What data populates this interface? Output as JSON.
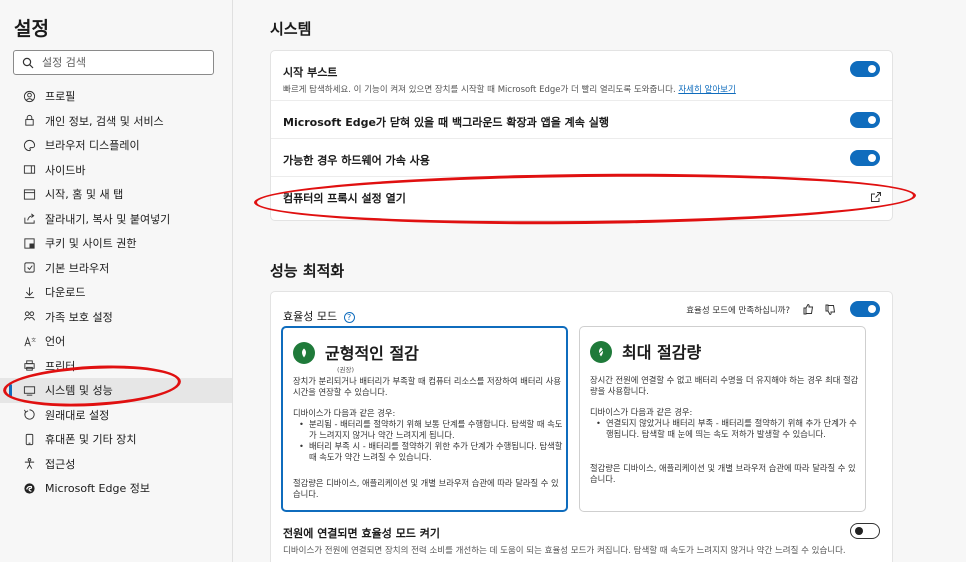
{
  "sidebar": {
    "title": "설정",
    "search_placeholder": "설정 검색",
    "items": [
      {
        "label": "프로필",
        "icon": "profile-icon"
      },
      {
        "label": "개인 정보, 검색 및 서비스",
        "icon": "lock-icon"
      },
      {
        "label": "브라우저 디스플레이",
        "icon": "palette-icon"
      },
      {
        "label": "사이드바",
        "icon": "sidebar-icon"
      },
      {
        "label": "시작, 홈 및 새 탭",
        "icon": "home-tab-icon"
      },
      {
        "label": "잘라내기, 복사 및 붙여넣기",
        "icon": "share-icon"
      },
      {
        "label": "쿠키 및 사이트 권한",
        "icon": "cookie-permissions-icon"
      },
      {
        "label": "기본 브라우저",
        "icon": "default-browser-icon"
      },
      {
        "label": "다운로드",
        "icon": "download-icon"
      },
      {
        "label": "가족 보호 설정",
        "icon": "family-icon"
      },
      {
        "label": "언어",
        "icon": "language-icon"
      },
      {
        "label": "프린터",
        "icon": "printer-icon"
      },
      {
        "label": "시스템 및 성능",
        "icon": "system-icon",
        "active": true
      },
      {
        "label": "원래대로 설정",
        "icon": "reset-icon"
      },
      {
        "label": "휴대폰 및 기타 장치",
        "icon": "phone-icon"
      },
      {
        "label": "접근성",
        "icon": "accessibility-icon"
      },
      {
        "label": "Microsoft Edge 정보",
        "icon": "edge-icon"
      }
    ]
  },
  "system": {
    "title": "시스템",
    "startup_boost": {
      "title": "시작 부스트",
      "desc": "빠르게 탐색하세요. 이 기능이 켜져 있으면 장치를 시작할 때 Microsoft Edge가 더 빨리 열리도록 도와줍니다.",
      "link": "자세히 알아보기",
      "enabled": true
    },
    "background": {
      "title": "Microsoft Edge가 닫혀 있을 때 백그라운드 확장과 앱을 계속 실행",
      "enabled": true
    },
    "hardware_accel": {
      "title": "가능한 경우 하드웨어 가속 사용",
      "enabled": true
    },
    "proxy": {
      "title": "컴퓨터의 프록시 설정 열기",
      "icon": "external-link-icon"
    }
  },
  "performance": {
    "title": "성능 최적화",
    "efficiency_mode": {
      "label": "효율성 모드",
      "feedback_prompt": "효율성 모드에 만족하십니까?",
      "enabled": true
    },
    "balanced": {
      "title": "균형적인 절감",
      "sub": "(권장)",
      "desc": "장치가 분리되거나 배터리가 부족할 때 컴퓨터 리소스를 저장하여 배터리 사용 시간을 연장할 수 있습니다.",
      "cond": "디바이스가 다음과 같은 경우:",
      "bullets": [
        "분리됨 - 배터리를 절약하기 위해 보통 단계를 수행합니다. 탐색할 때 속도가 느려지지 않거나 약간 느려지게 됩니다.",
        "배터리 부족 시 - 배터리를 절약하기 위한 추가 단계가 수행됩니다. 탐색할 때 속도가 약간 느려질 수 있습니다."
      ],
      "footer": "절감량은 디바이스, 애플리케이션 및 개별 브라우저 습관에 따라 달라질 수 있습니다."
    },
    "max": {
      "title": "최대 절감량",
      "desc": "장시간 전원에 연결할 수 없고 배터리 수명을 더 유지해야 하는 경우 최대 절감량을 사용합니다.",
      "cond": "디바이스가 다음과 같은 경우:",
      "bullets": [
        "연결되지 않았거나 배터리 부족 - 배터리를 절약하기 위해 추가 단계가 수행됩니다. 탐색할 때 눈에 띄는 속도 저하가 발생할 수 있습니다."
      ],
      "footer": "절감량은 디바이스, 애플리케이션 및 개별 브라우저 습관에 따라 달라질 수 있습니다."
    },
    "plugged": {
      "title": "전원에 연결되면 효율성 모드 켜기",
      "desc": "디바이스가 전원에 연결되면 장치의 전력 소비를 개선하는 데 도움이 되는 효율성 모드가 켜집니다. 탐색할 때 속도가 느려지지 않거나 약간 느려질 수 있습니다.",
      "enabled": false
    }
  },
  "colors": {
    "accent": "#0f6cbd",
    "annotation": "#e01010",
    "leaf": "#1f7a3a"
  }
}
